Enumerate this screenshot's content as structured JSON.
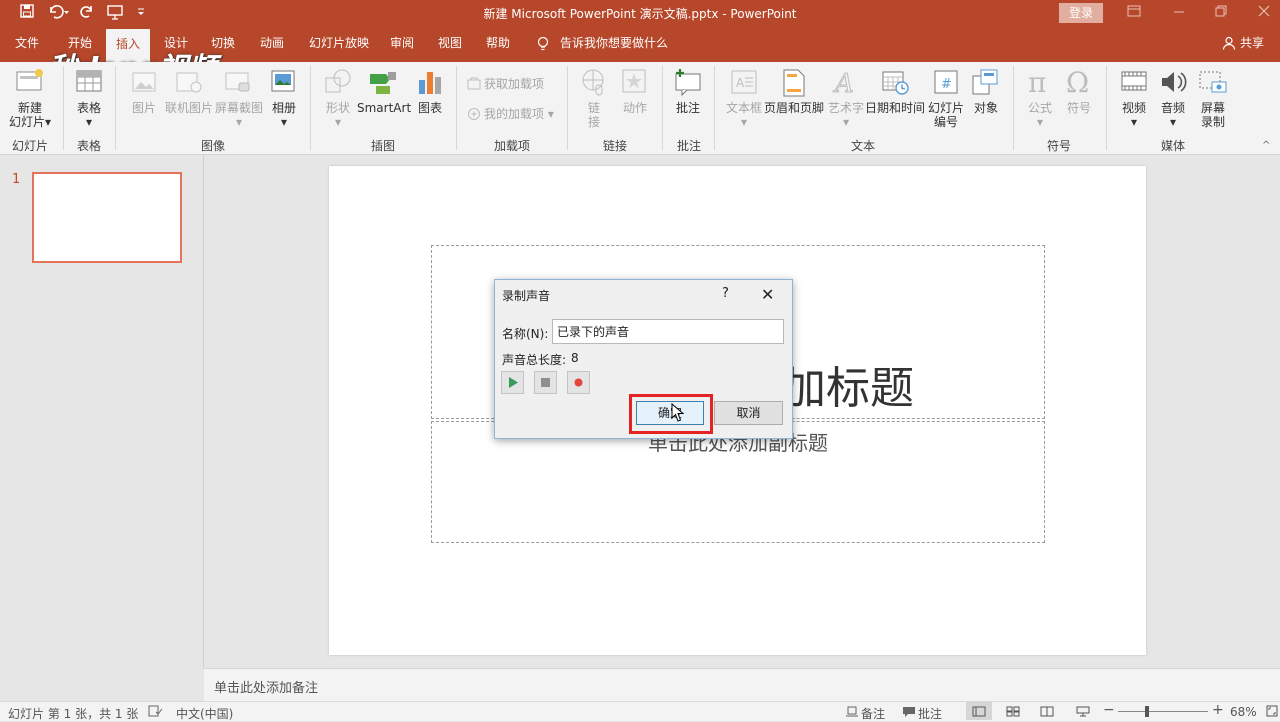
{
  "window": {
    "title": "新建 Microsoft PowerPoint 演示文稿.pptx  -  PowerPoint",
    "login": "登录"
  },
  "tabs": {
    "file": "文件",
    "home": "开始",
    "insert": "插入",
    "design": "设计",
    "transitions": "切换",
    "animations": "动画",
    "slideshow": "幻灯片放映",
    "review": "审阅",
    "view": "视图",
    "help": "帮助",
    "tellme": "告诉我你想要做什么",
    "share": "共享"
  },
  "watermark": "秒dong视频",
  "ribbon": {
    "new_slide_1": "新建",
    "new_slide_2": "幻灯片",
    "table": "表格",
    "picture": "图片",
    "online_picture": "联机图片",
    "screenshot": "屏幕截图",
    "album": "相册",
    "shapes": "形状",
    "smartart": "SmartArt",
    "chart": "图表",
    "get_addins": "获取加载项",
    "my_addins": "我的加载项",
    "link_1": "链",
    "link_2": "接",
    "action": "动作",
    "comment": "批注",
    "textbox": "文本框",
    "header_footer": "页眉和页脚",
    "wordart": "艺术字",
    "datetime": "日期和时间",
    "slide_number_1": "幻灯片",
    "slide_number_2": "编号",
    "object": "对象",
    "equation": "公式",
    "symbol": "符号",
    "video": "视频",
    "audio": "音频",
    "screen_rec_1": "屏幕",
    "screen_rec_2": "录制",
    "groups": {
      "slides": "幻灯片",
      "tables": "表格",
      "images": "图像",
      "illustrations": "插图",
      "addins": "加载项",
      "links": "链接",
      "comments": "批注",
      "text": "文本",
      "symbols": "符号",
      "media": "媒体"
    }
  },
  "thumbnail": {
    "number": "1"
  },
  "slide": {
    "title_placeholder": "单击此处添加标题",
    "subtitle_placeholder": "单击此处添加副标题"
  },
  "notes": "单击此处添加备注",
  "status": {
    "slide_info": "幻灯片 第 1 张，共 1 张",
    "language": "中文(中国)",
    "notes": "备注",
    "comments": "批注",
    "zoom": "68%"
  },
  "dialog": {
    "title": "录制声音",
    "help": "?",
    "close": "✕",
    "name_label": "名称(N):",
    "name_value": "已录下的声音",
    "length_label": "声音总长度:",
    "length_value": "8",
    "ok": "确定",
    "cancel": "取消"
  },
  "colors": {
    "accent": "#b7472a",
    "ribbon_bg": "#f3f3f3",
    "highlight": "#e52323"
  }
}
